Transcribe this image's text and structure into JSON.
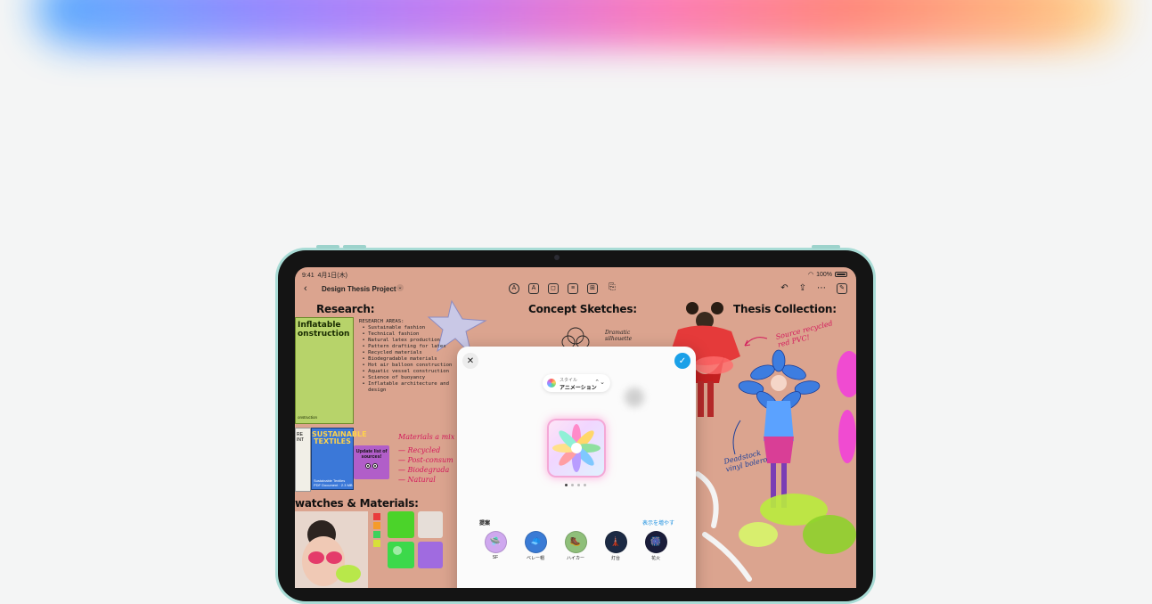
{
  "status": {
    "time": "9:41",
    "date": "4月1日(木)",
    "battery": "100%"
  },
  "toolbar": {
    "back": "‹",
    "title": "Design Thesis Project",
    "chevron": "⌄"
  },
  "canvas": {
    "research_heading": "Research:",
    "concept_heading": "Concept Sketches:",
    "thesis_heading": "Thesis Collection:",
    "swatches_heading": "watches & Materials:",
    "research_list": "RESEARCH AREAS:\n • Sustainable fashion\n • Technical fashion\n • Natural latex production\n • Pattern drafting for latex\n • Recycled materials\n • Biodegradable materials\n • Hot air balloon construction\n • Aquatic vessel construction\n • Science of buoyancy\n • Inflatable architecture and\n   design",
    "poster_green_title": "Inflatable\nonstruction",
    "poster_green_footer": "onstruction",
    "poster_blue_title": "SUSTAINABLE\nTEXTILES",
    "poster_blue_footer": "Sustainable Textiles\nPDF Document · 2.3 MB",
    "bw_card": "RE\nINT",
    "sticky_note": "Update list of sources!",
    "hand_materials": "Materials a mix o",
    "hand_list": "— Recycled\n— Post-consum\n— Biodegrada\n— Natural",
    "hand_dramatic": "Dramatic\nsilhouette",
    "hand_source": "Source recycled\nred PVC!",
    "hand_deadstock": "Deadstock\nvinyl bolero"
  },
  "modal": {
    "close": "✕",
    "done": "✓",
    "style_label": "スタイル",
    "style_value": "アニメーション",
    "style_arrow": "⌃⌄",
    "suggestions_label": "提案",
    "show_more": "表示を増やす",
    "items": [
      {
        "label": "SF",
        "icon": "🛸"
      },
      {
        "label": "ベレー帽",
        "icon": "🧢"
      },
      {
        "label": "ハイカー",
        "icon": "🥾"
      },
      {
        "label": "灯台",
        "icon": "🗼"
      },
      {
        "label": "花火",
        "icon": "🎆"
      }
    ]
  },
  "colors": {
    "canvas_bg": "#dba48f",
    "accent_blue": "#1aa0e8",
    "handwriting": "#d3195b"
  }
}
